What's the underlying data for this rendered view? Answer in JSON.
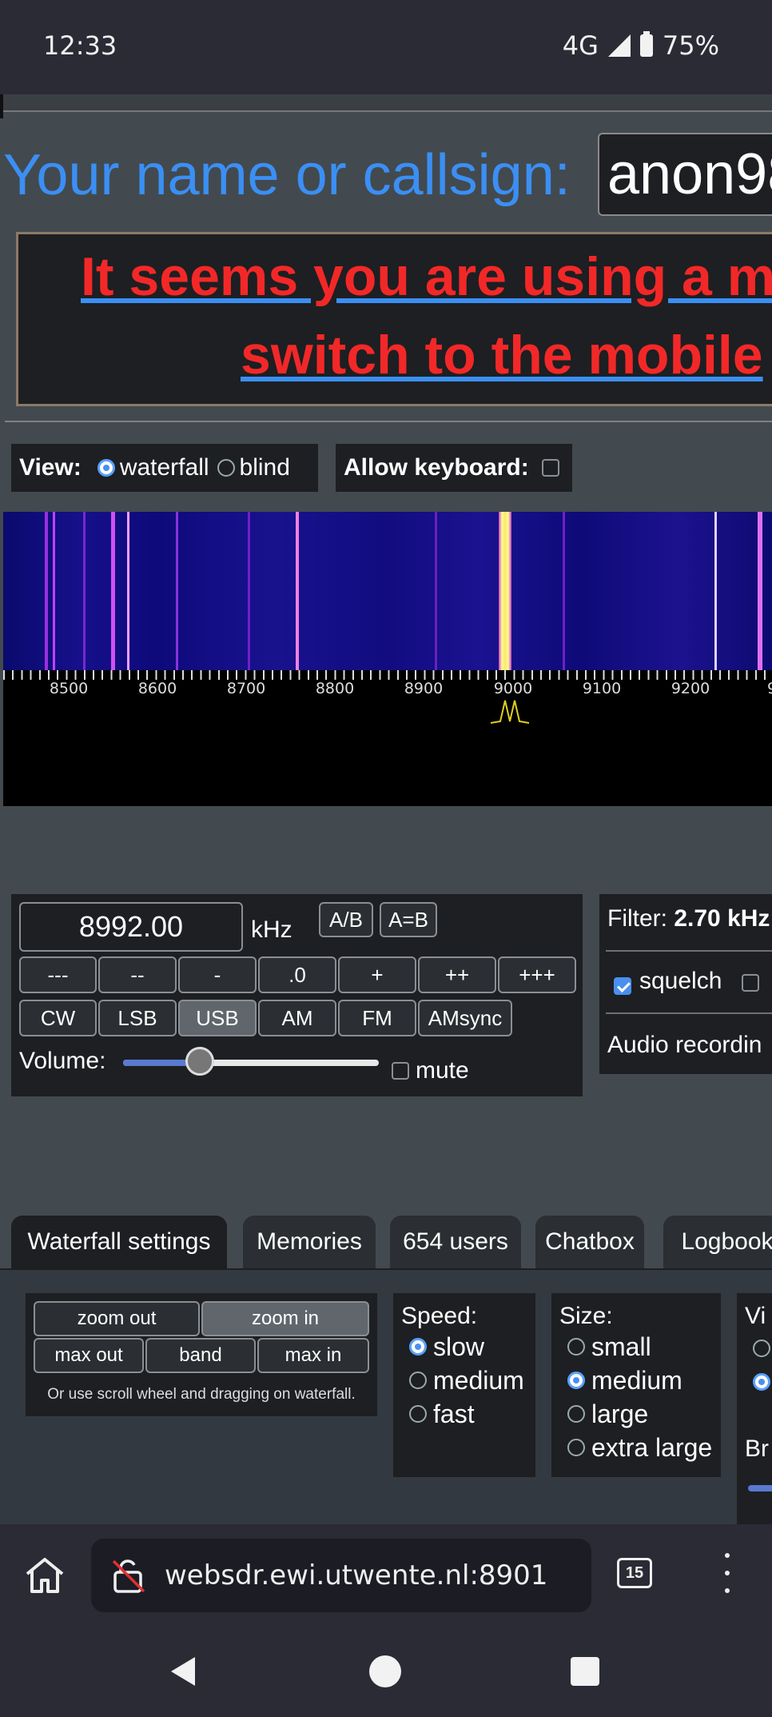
{
  "status_bar": {
    "time": "12:33",
    "network": "4G",
    "battery": "75%"
  },
  "callsign": {
    "label": "Your name or callsign:",
    "value": "anon98"
  },
  "warning": {
    "line1": "It seems you are using a m",
    "line2": "switch to the mobile"
  },
  "view": {
    "label": "View:",
    "options": [
      "waterfall",
      "blind"
    ],
    "selected": "waterfall"
  },
  "keyboard": {
    "label": "Allow keyboard:",
    "checked": false
  },
  "waterfall": {
    "freq_labels": [
      "8500",
      "8600",
      "8700",
      "8800",
      "8900",
      "9000",
      "9100",
      "9200",
      "9"
    ]
  },
  "tuning": {
    "frequency": "8992.00",
    "unit": "kHz",
    "ab_buttons": [
      "A/B",
      "A=B"
    ],
    "step_buttons": [
      "---",
      "--",
      "-",
      ".0",
      "+",
      "++",
      "+++"
    ],
    "modes": [
      "CW",
      "LSB",
      "USB",
      "AM",
      "FM",
      "AMsync"
    ],
    "selected_mode": "USB",
    "volume_label": "Volume:",
    "volume_level": 0.3,
    "mute_label": "mute"
  },
  "filter": {
    "label": "Filter:",
    "value": "2.70 kHz",
    "squelch_label": "squelch",
    "squelch_checked": true,
    "audio_recording": "Audio recordin"
  },
  "tabs": [
    "Waterfall settings",
    "Memories",
    "654 users",
    "Chatbox",
    "Logbook"
  ],
  "zoom": {
    "buttons_row1": [
      "zoom out",
      "zoom in"
    ],
    "buttons_row2": [
      "max out",
      "band",
      "max in"
    ],
    "hint": "Or use scroll wheel and dragging on waterfall."
  },
  "speed": {
    "label": "Speed:",
    "options": [
      "slow",
      "medium",
      "fast"
    ],
    "selected": "slow"
  },
  "size": {
    "label": "Size:",
    "options": [
      "small",
      "medium",
      "large",
      "extra large"
    ],
    "selected": "medium"
  },
  "view_partial": {
    "label": "Vi",
    "brightness_label": "Br"
  },
  "browser": {
    "url": "websdr.ewi.utwente.nl:8901",
    "tab_count": "15"
  },
  "colors": {
    "accent": "#3b8ff4",
    "warning": "#f22828",
    "panel": "#1d1f22",
    "background": "#424a4f"
  }
}
